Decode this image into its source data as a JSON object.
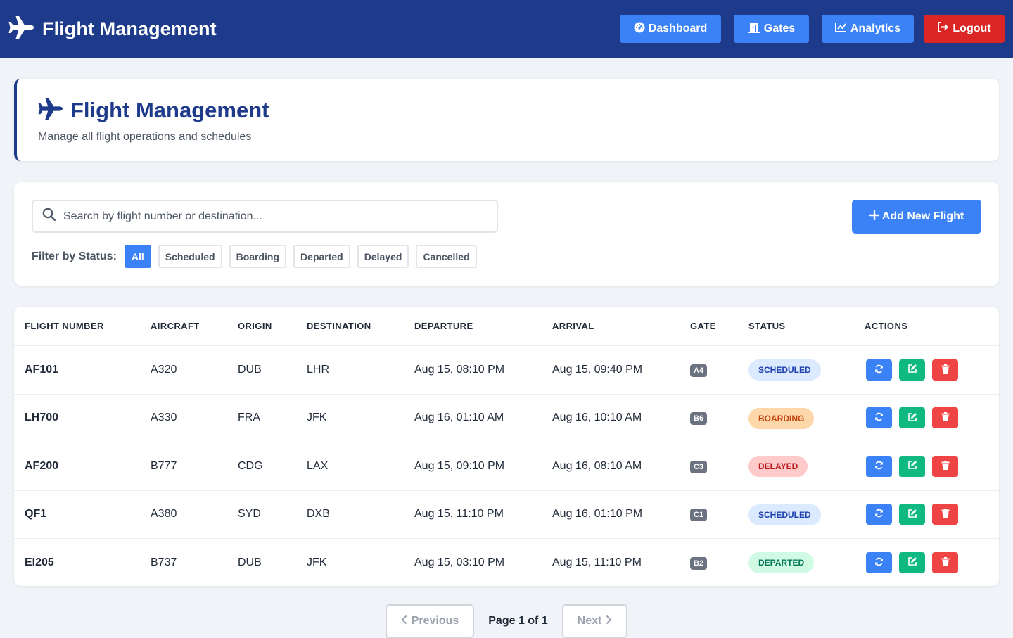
{
  "navbar": {
    "title": "Flight Management",
    "buttons": {
      "dashboard": "Dashboard",
      "gates": "Gates",
      "analytics": "Analytics",
      "logout": "Logout"
    }
  },
  "header": {
    "title": "Flight Management",
    "subtitle": "Manage all flight operations and schedules"
  },
  "controls": {
    "search_placeholder": "Search by flight number or destination...",
    "search_value": "",
    "add_button": "Add New Flight",
    "filter_label": "Filter by Status:",
    "filters": [
      "All",
      "Scheduled",
      "Boarding",
      "Departed",
      "Delayed",
      "Cancelled"
    ],
    "active_filter": "All"
  },
  "table": {
    "columns": [
      "FLIGHT NUMBER",
      "AIRCRAFT",
      "ORIGIN",
      "DESTINATION",
      "DEPARTURE",
      "ARRIVAL",
      "GATE",
      "STATUS",
      "ACTIONS"
    ],
    "rows": [
      {
        "flight": "AF101",
        "aircraft": "A320",
        "origin": "DUB",
        "destination": "LHR",
        "departure": "Aug 15, 08:10 PM",
        "arrival": "Aug 15, 09:40 PM",
        "gate": "A4",
        "status": "SCHEDULED",
        "status_key": "scheduled"
      },
      {
        "flight": "LH700",
        "aircraft": "A330",
        "origin": "FRA",
        "destination": "JFK",
        "departure": "Aug 16, 01:10 AM",
        "arrival": "Aug 16, 10:10 AM",
        "gate": "B6",
        "status": "BOARDING",
        "status_key": "boarding"
      },
      {
        "flight": "AF200",
        "aircraft": "B777",
        "origin": "CDG",
        "destination": "LAX",
        "departure": "Aug 15, 09:10 PM",
        "arrival": "Aug 16, 08:10 AM",
        "gate": "C3",
        "status": "DELAYED",
        "status_key": "delayed"
      },
      {
        "flight": "QF1",
        "aircraft": "A380",
        "origin": "SYD",
        "destination": "DXB",
        "departure": "Aug 15, 11:10 PM",
        "arrival": "Aug 16, 01:10 PM",
        "gate": "C1",
        "status": "SCHEDULED",
        "status_key": "scheduled"
      },
      {
        "flight": "EI205",
        "aircraft": "B737",
        "origin": "DUB",
        "destination": "JFK",
        "departure": "Aug 15, 03:10 PM",
        "arrival": "Aug 15, 11:10 PM",
        "gate": "B2",
        "status": "DEPARTED",
        "status_key": "departed"
      }
    ]
  },
  "pagination": {
    "previous": "Previous",
    "info": "Page 1 of 1",
    "next": "Next"
  },
  "colors": {
    "primary_dark": "#1e3a8a",
    "primary": "#3b82f6",
    "danger": "#dc2626",
    "success": "#10b981"
  }
}
